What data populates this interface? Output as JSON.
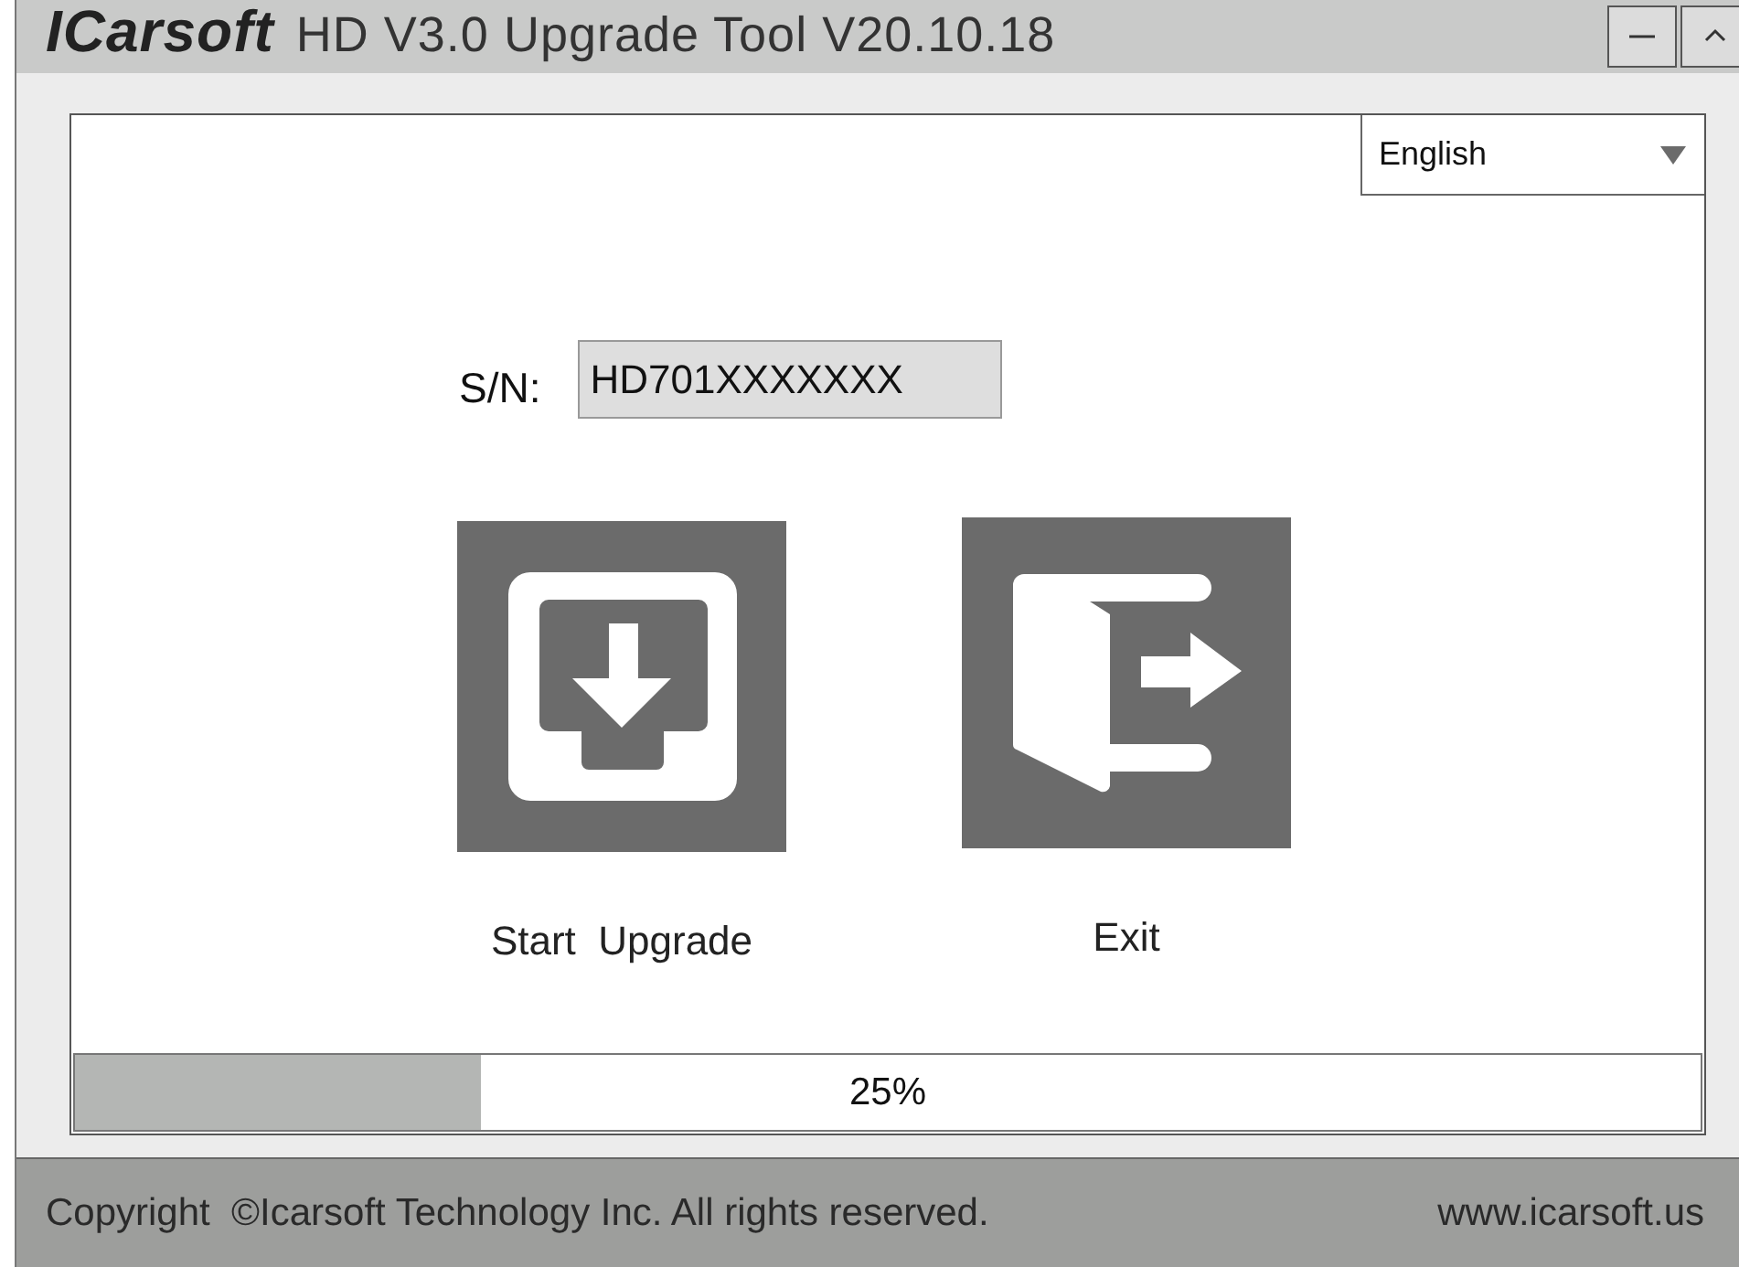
{
  "window": {
    "brand": "ICarsoft",
    "title": "HD V3.0 Upgrade Tool V20.10.18"
  },
  "language": {
    "value": "English"
  },
  "serial": {
    "label": "S/N:",
    "value": "HD701XXXXXXX"
  },
  "actions": [
    {
      "kind": "upgrade",
      "label": "Start  Upgrade"
    },
    {
      "kind": "exit",
      "label": "Exit"
    }
  ],
  "progress": {
    "level": 0.25,
    "reading": "25%"
  },
  "footer": {
    "copyright": "Copyright  ©Icarsoft Technology Inc. All rights reserved.",
    "website": "www.icarsoft.us"
  }
}
